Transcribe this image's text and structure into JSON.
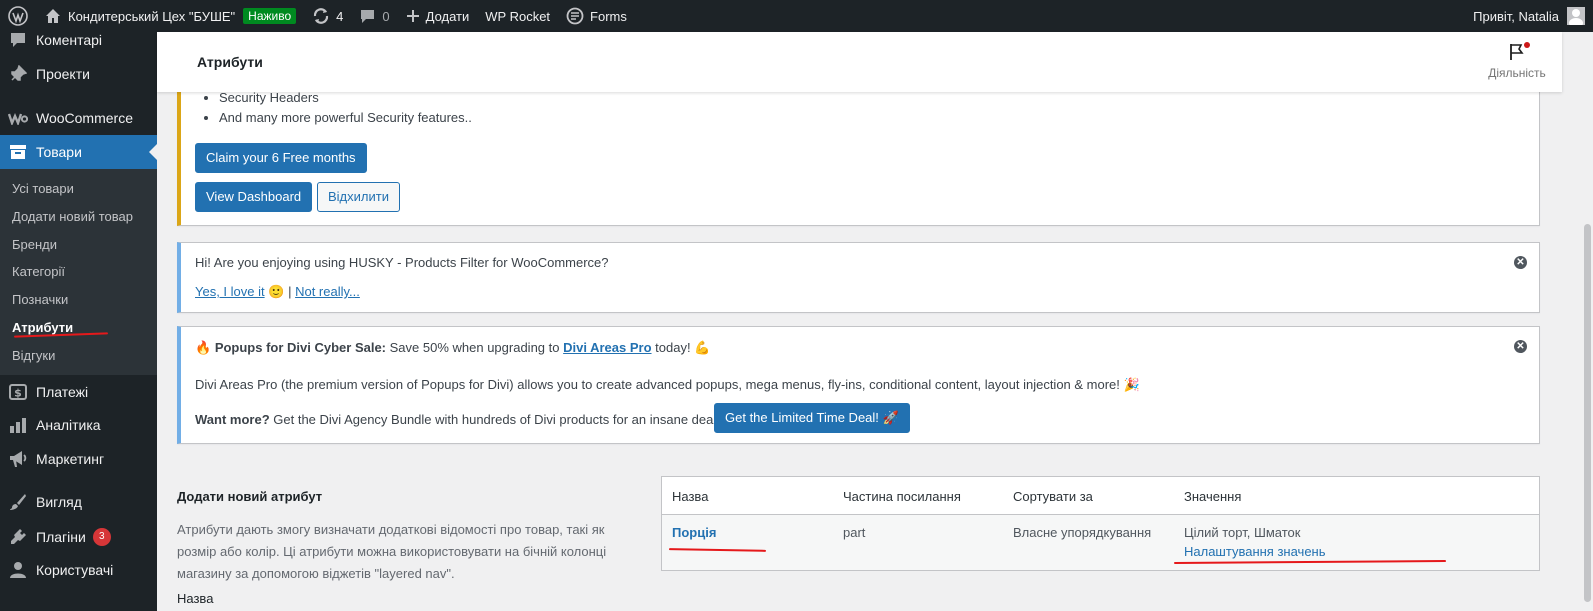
{
  "adminbar": {
    "site_name": "Кондитерський Цех \"БУШЕ\"",
    "live_badge": "Наживо",
    "updates_count": "4",
    "comments_count": "0",
    "add_new": "Додати",
    "wp_rocket": "WP Rocket",
    "forms": "Forms",
    "greeting": "Привіт, Natalia"
  },
  "sidebar": {
    "items": [
      {
        "label": "Коментарі",
        "icon": "comment-icon"
      },
      {
        "label": "Проекти",
        "icon": "pin-icon"
      },
      {
        "label": "WooCommerce",
        "icon": "woo-icon"
      },
      {
        "label": "Товари",
        "icon": "archive-icon"
      },
      {
        "label": "Платежі",
        "icon": "dollar-icon"
      },
      {
        "label": "Аналітика",
        "icon": "bar-chart-icon"
      },
      {
        "label": "Маркетинг",
        "icon": "megaphone-icon"
      },
      {
        "label": "Вигляд",
        "icon": "brush-icon"
      },
      {
        "label": "Плагіни",
        "icon": "plugin-icon"
      },
      {
        "label": "Користувачі",
        "icon": "user-icon"
      }
    ],
    "plugins_badge": "3",
    "submenu": [
      "Усі товари",
      "Додати новий товар",
      "Бренди",
      "Категорії",
      "Позначки",
      "Атрибути",
      "Відгуки"
    ]
  },
  "header": {
    "title": "Атрибути",
    "activity_label": "Діяльність"
  },
  "notice_security": {
    "items": [
      "Security Headers",
      "And many more powerful Security features.."
    ],
    "claim_button": "Claim your 6 Free months",
    "dashboard_button": "View Dashboard",
    "dismiss_button": "Відхилити"
  },
  "notice_husky": {
    "question": "Hi! Are you enjoying using HUSKY - Products Filter for WooCommerce?",
    "yes_link": "Yes, I love it",
    "smile": "🙂",
    "separator": "|",
    "no_link": "Not really..."
  },
  "notice_divi": {
    "fire": "🔥",
    "headline_bold": "Popups for Divi Cyber Sale:",
    "headline_text": "Save 50% when upgrading to",
    "link": "Divi Areas Pro",
    "headline_end": "today!",
    "muscle": "💪",
    "body": "Divi Areas Pro (the premium version of Popups for Divi) allows you to create advanced popups, mega menus, fly-ins, conditional content, layout injection & more!",
    "party": "🎉",
    "want_bold": "Want more?",
    "want_text": "Get the Divi Agency Bundle with hundreds of Divi products for an insane deal!",
    "deal_button": "Get the Limited Time Deal!",
    "rocket": "🚀"
  },
  "add_attribute": {
    "title": "Додати новий атрибут",
    "description": "Атрибути дають змогу визначати додаткові відомості про товар, такі як розмір або колір. Ці атрибути можна використовувати на бічній колонці магазину за допомогою віджетів \"layered nav\".",
    "name_label": "Назва"
  },
  "table": {
    "headers": [
      "Назва",
      "Частина посилання",
      "Сортувати за",
      "Значення"
    ],
    "rows": [
      {
        "name": "Порція",
        "slug": "part",
        "order": "Власне упорядкування",
        "values": "Цілий торт, Шматок",
        "configure": "Налаштування значень"
      }
    ]
  },
  "colors": {
    "admin_dark": "#1d2327",
    "primary": "#2271b1",
    "warning": "#dba617",
    "info": "#72aee6",
    "annotation": "#e5191b"
  }
}
